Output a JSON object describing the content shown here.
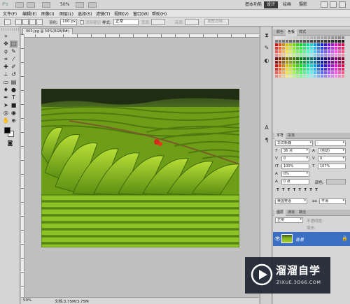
{
  "appbar": {
    "logo": "Ps",
    "zoom": "50%",
    "workspaces": [
      "基本功能",
      "设计",
      "绘画",
      "摄影"
    ],
    "active_workspace": "设计",
    "window_controls": [
      "minimize-icon",
      "restore-icon",
      "close-icon"
    ]
  },
  "menubar": {
    "items": [
      "文件(F)",
      "编辑(E)",
      "图像(I)",
      "图层(L)",
      "选择(S)",
      "滤镜(T)",
      "视图(V)",
      "窗口(W)",
      "帮助(H)"
    ]
  },
  "options": {
    "feather_label": "羽化:",
    "feather_value": "100 px",
    "antialias_label": "消除锯齿",
    "style_label": "样式:",
    "style_value": "正常",
    "width_label": "宽度:",
    "height_label": "高度:",
    "refine_edge_label": "调整边缘..."
  },
  "document": {
    "tab_title": "003.jpg @ 50%(RGB/8#)",
    "zoom": "50%",
    "doc_info": "文档:3.75M/3.75M"
  },
  "panels": {
    "swatch_tabs": [
      "颜色",
      "色板",
      "样式"
    ],
    "char_tabs": [
      "字符",
      "段落"
    ],
    "font_family": "华文新魏",
    "font_style": "-",
    "font_size": "36 点",
    "leading": "(自动)",
    "kerning": "0",
    "tracking": "0",
    "vscale": "100%",
    "hscale": "107%",
    "baseline_shift": "0%",
    "color_label": "颜色:",
    "baseline": "0 点",
    "language": "美国英语",
    "antialias": "平滑",
    "layer_tabs": [
      "图层",
      "通道",
      "路径"
    ],
    "blend_mode": "正常",
    "opacity_label": "不透明度:",
    "fill_label": "填充:",
    "layer_name": "背景"
  },
  "watermark": {
    "title": "溜溜自学",
    "url": "ZIXUE.3D66.COM"
  },
  "colors": {
    "accent": "#3b6fc4",
    "watermark_bg": "#1a202c"
  }
}
